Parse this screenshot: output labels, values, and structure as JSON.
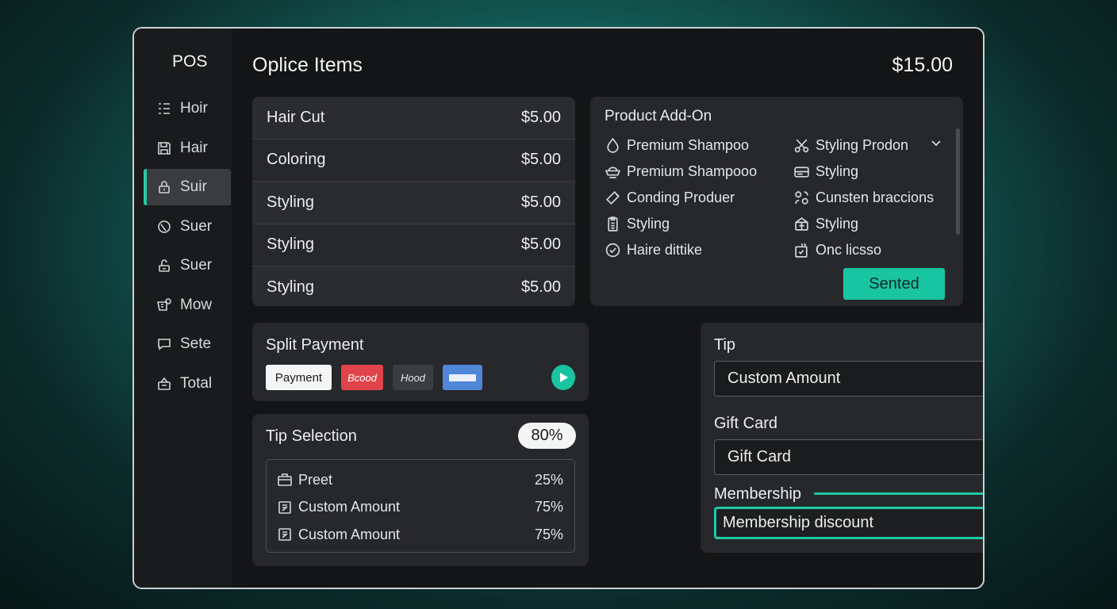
{
  "sidebar": {
    "logo": "POS",
    "items": [
      {
        "label": "Hoir",
        "icon": "grid-icon"
      },
      {
        "label": "Hair",
        "icon": "save-icon"
      },
      {
        "label": "Suir",
        "icon": "lock-icon",
        "active": true
      },
      {
        "label": "Suer",
        "icon": "circle-icon"
      },
      {
        "label": "Suer",
        "icon": "lock-open-icon"
      },
      {
        "label": "Mow",
        "icon": "register-icon"
      },
      {
        "label": "Sete",
        "icon": "chat-icon"
      },
      {
        "label": "Total",
        "icon": "bag-icon"
      }
    ]
  },
  "header": {
    "title": "Oplice Items",
    "total": "$15.00"
  },
  "items": [
    {
      "name": "Hair Cut",
      "price": "$5.00"
    },
    {
      "name": "Coloring",
      "price": "$5.00"
    },
    {
      "name": "Styling",
      "price": "$5.00"
    },
    {
      "name": "Styling",
      "price": "$5.00"
    },
    {
      "name": "Styling",
      "price": "$5.00"
    }
  ],
  "addons": {
    "title": "Product Add-On",
    "col1": [
      {
        "label": "Premium Shampoo",
        "icon": "droplet-icon"
      },
      {
        "label": "Premium Shampooo",
        "icon": "bowl-icon"
      },
      {
        "label": "Conding Produer",
        "icon": "tag-icon"
      },
      {
        "label": "Styling",
        "icon": "clipboard-icon"
      },
      {
        "label": "Haire dittike",
        "icon": "check-circle-icon"
      }
    ],
    "col2": [
      {
        "label": "Styling Prodon",
        "icon": "scissors-icon"
      },
      {
        "label": "Styling",
        "icon": "card-icon"
      },
      {
        "label": "Cunsten braccions",
        "icon": "people-icon"
      },
      {
        "label": "Styling",
        "icon": "gift-icon"
      },
      {
        "label": "Onc licsso",
        "icon": "package-check-icon"
      }
    ],
    "button": "Sented"
  },
  "split": {
    "title": "Split Payment",
    "buttons": {
      "payment": "Payment",
      "red": "Bcood",
      "dark": "Hood"
    }
  },
  "tip_selection": {
    "title": "Tip Selection",
    "badge": "80%",
    "rows": [
      {
        "label": "Preet",
        "value": "25%",
        "icon": "briefcase-icon"
      },
      {
        "label": "Custom Amount",
        "value": "75%",
        "icon": "edit-icon"
      },
      {
        "label": "Custom Amount",
        "value": "75%",
        "icon": "edit-icon"
      }
    ]
  },
  "right": {
    "tip_label": "Tip",
    "tip_value": "Custom Amount",
    "gift_label": "Gift Card",
    "gift_value": "Gift Card",
    "member_label": "Membership",
    "member_value": "Membership discount"
  },
  "colors": {
    "accent": "#19c4a0",
    "red": "#e0434a",
    "blue": "#4f86d8"
  }
}
